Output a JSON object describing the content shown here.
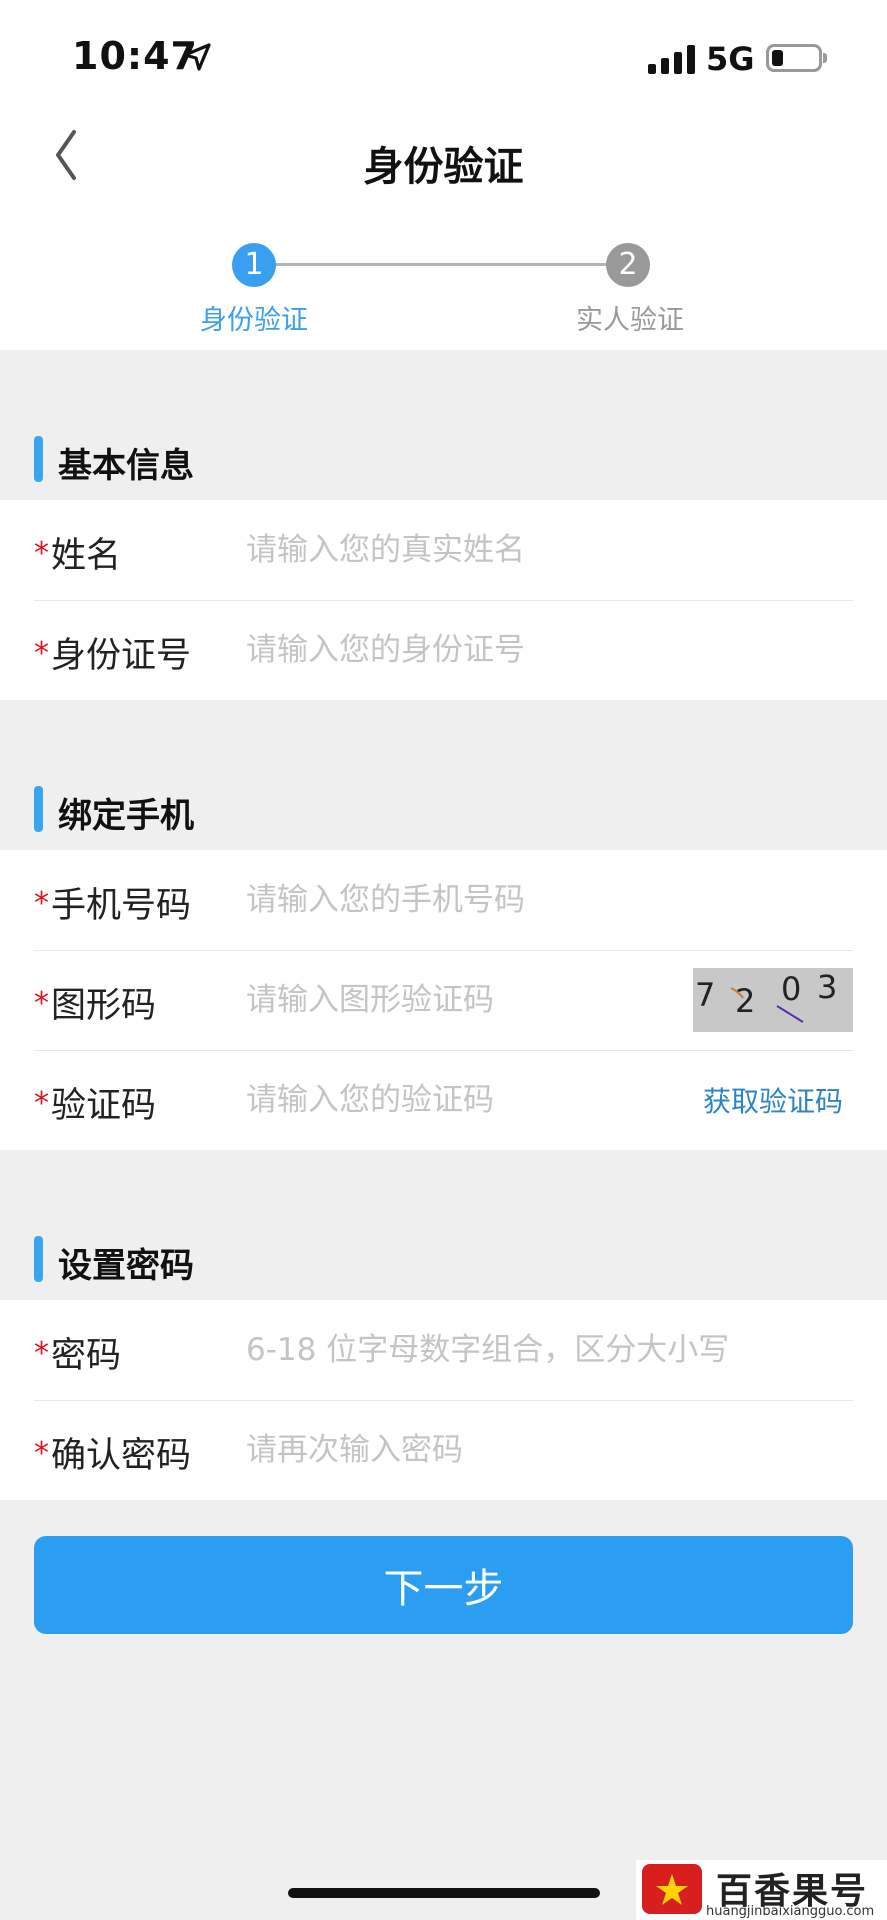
{
  "status_bar": {
    "time": "10:47",
    "network": "5G"
  },
  "nav": {
    "title": "身份验证"
  },
  "steps": [
    {
      "number": "1",
      "label": "身份验证",
      "active": true
    },
    {
      "number": "2",
      "label": "实人验证",
      "active": false
    }
  ],
  "sections": {
    "basic": {
      "title": "基本信息",
      "name": {
        "required": "*",
        "label": "姓名",
        "placeholder": "请输入您的真实姓名"
      },
      "id_number": {
        "required": "*",
        "label": "身份证号",
        "placeholder": "请输入您的身份证号"
      }
    },
    "phone": {
      "title": "绑定手机",
      "mobile": {
        "required": "*",
        "label": "手机号码",
        "placeholder": "请输入您的手机号码"
      },
      "captcha": {
        "required": "*",
        "label": "图形码",
        "placeholder": "请输入图形验证码",
        "digits": [
          "7",
          "2",
          "0",
          "3"
        ]
      },
      "code": {
        "required": "*",
        "label": "验证码",
        "placeholder": "请输入您的验证码",
        "action": "获取验证码"
      }
    },
    "password": {
      "title": "设置密码",
      "password": {
        "required": "*",
        "label": "密码",
        "placeholder": "6-18 位字母数字组合，区分大小写"
      },
      "confirm": {
        "required": "*",
        "label": "确认密码",
        "placeholder": "请再次输入密码"
      }
    }
  },
  "next_button": "下一步",
  "watermark": {
    "brand": "百香果号",
    "url": "huangjinbaixiangguo.com"
  },
  "colors": {
    "accent": "#2b9ef2",
    "required": "#d9161b",
    "link": "#2c83c9"
  }
}
